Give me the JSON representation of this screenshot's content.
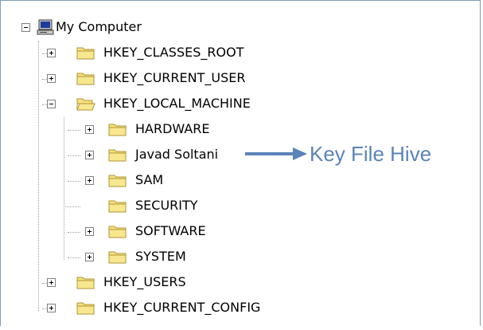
{
  "tree": {
    "root": {
      "label": "My Computer",
      "icon": "computer-icon",
      "expanded": true
    },
    "hives": [
      {
        "label": "HKEY_CLASSES_ROOT",
        "expanded": false
      },
      {
        "label": "HKEY_CURRENT_USER",
        "expanded": false
      },
      {
        "label": "HKEY_LOCAL_MACHINE",
        "expanded": true
      },
      {
        "label": "HKEY_USERS",
        "expanded": false
      },
      {
        "label": "HKEY_CURRENT_CONFIG",
        "expanded": false
      }
    ],
    "hklm_children": [
      {
        "label": "HARDWARE",
        "has_children": true
      },
      {
        "label": "Javad Soltani",
        "has_children": true
      },
      {
        "label": "SAM",
        "has_children": true
      },
      {
        "label": "SECURITY",
        "has_children": false
      },
      {
        "label": "SOFTWARE",
        "has_children": true
      },
      {
        "label": "SYSTEM",
        "has_children": true
      }
    ]
  },
  "annotation": {
    "text": "Key File Hive",
    "color": "#5b84b8"
  },
  "colors": {
    "border": "#7f9db9",
    "folder_fill": "#f5e27a",
    "folder_edge": "#b0943a",
    "dotted": "#a0a0a0"
  }
}
